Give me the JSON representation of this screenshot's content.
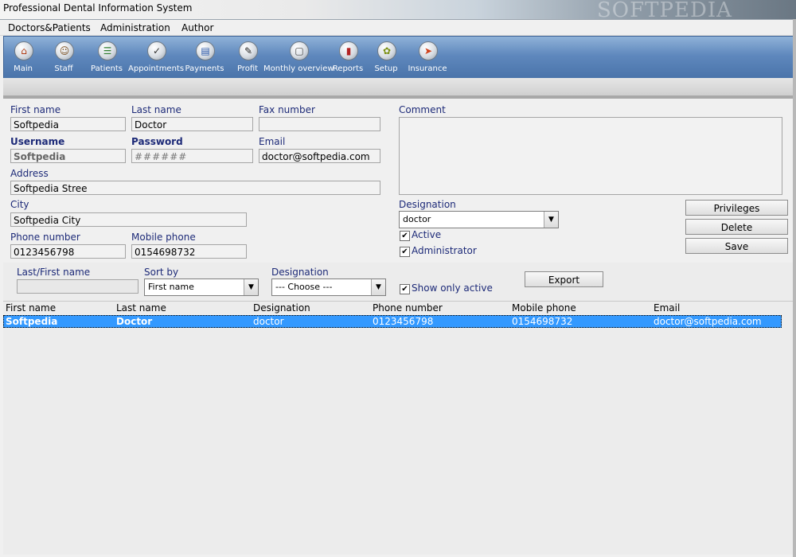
{
  "window": {
    "title": "Professional Dental Information System",
    "watermark": "SOFTPEDIA"
  },
  "menu": [
    "Doctors&Patients",
    "Administration",
    "Author"
  ],
  "toolbar": [
    {
      "label": "Main",
      "icon": "home-icon"
    },
    {
      "label": "Staff",
      "icon": "staff-icon"
    },
    {
      "label": "Patients",
      "icon": "patients-icon"
    },
    {
      "label": "Appointments",
      "icon": "appointments-icon"
    },
    {
      "label": "Payments",
      "icon": "payments-icon"
    },
    {
      "label": "Profit",
      "icon": "profit-icon"
    },
    {
      "label": "Monthly overview",
      "icon": "monthly-overview-icon"
    },
    {
      "label": "Reports",
      "icon": "reports-icon"
    },
    {
      "label": "Setup",
      "icon": "setup-icon"
    },
    {
      "label": "Insurance",
      "icon": "insurance-icon"
    }
  ],
  "form": {
    "first_name": {
      "label": "First name",
      "value": "Softpedia"
    },
    "last_name": {
      "label": "Last name",
      "value": "Doctor"
    },
    "fax": {
      "label": "Fax number",
      "value": ""
    },
    "comment": {
      "label": "Comment",
      "value": ""
    },
    "username": {
      "label": "Username",
      "value": "Softpedia"
    },
    "password": {
      "label": "Password",
      "value": "######"
    },
    "email": {
      "label": "Email",
      "value": "doctor@softpedia.com"
    },
    "address": {
      "label": "Address",
      "value": "Softpedia Stree"
    },
    "city": {
      "label": "City",
      "value": "Softpedia City"
    },
    "phone": {
      "label": "Phone number",
      "value": "0123456798"
    },
    "mobile": {
      "label": "Mobile phone",
      "value": "0154698732"
    },
    "designation": {
      "label": "Designation",
      "value": "doctor"
    },
    "active": {
      "label": "Active",
      "checked": true
    },
    "administrator": {
      "label": "Administrator",
      "checked": true
    },
    "buttons": {
      "privileges": "Privileges",
      "delete": "Delete",
      "save": "Save"
    }
  },
  "filter": {
    "name": {
      "label": "Last/First name",
      "value": ""
    },
    "sort_by": {
      "label": "Sort by",
      "value": "First name"
    },
    "designation": {
      "label": "Designation",
      "value": "--- Choose ---"
    },
    "show_only_active": {
      "label": "Show only active",
      "checked": true
    },
    "export": "Export"
  },
  "table": {
    "columns": [
      "First name",
      "Last name",
      "Designation",
      "Phone number",
      "Mobile phone",
      "Email"
    ],
    "rows": [
      [
        "Softpedia",
        "Doctor",
        "doctor",
        "0123456798",
        "0154698732",
        "doctor@softpedia.com"
      ]
    ]
  },
  "colors": {
    "toolbar": "#5f88bd",
    "selection": "#3399ff",
    "label": "#1d2a78"
  }
}
